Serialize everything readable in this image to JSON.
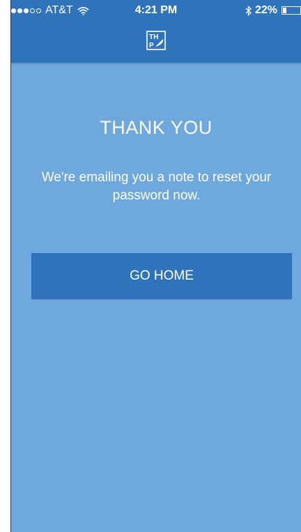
{
  "status_bar": {
    "carrier": "AT&T",
    "time": "4:21 PM",
    "battery_percent": "22%",
    "battery_level": 0.22,
    "signal_bars_filled": 3,
    "signal_bars_total": 5
  },
  "header": {
    "logo_icon": "thp-quill-logo",
    "logo_text": "THP"
  },
  "main": {
    "title": "THANK YOU",
    "message": "We're emailing you a note to reset your password now.",
    "button_label": "GO HOME"
  },
  "colors": {
    "background": "#6fa8dc",
    "header": "#2f74ba",
    "button": "#2f74ba",
    "text": "#ffffff"
  }
}
